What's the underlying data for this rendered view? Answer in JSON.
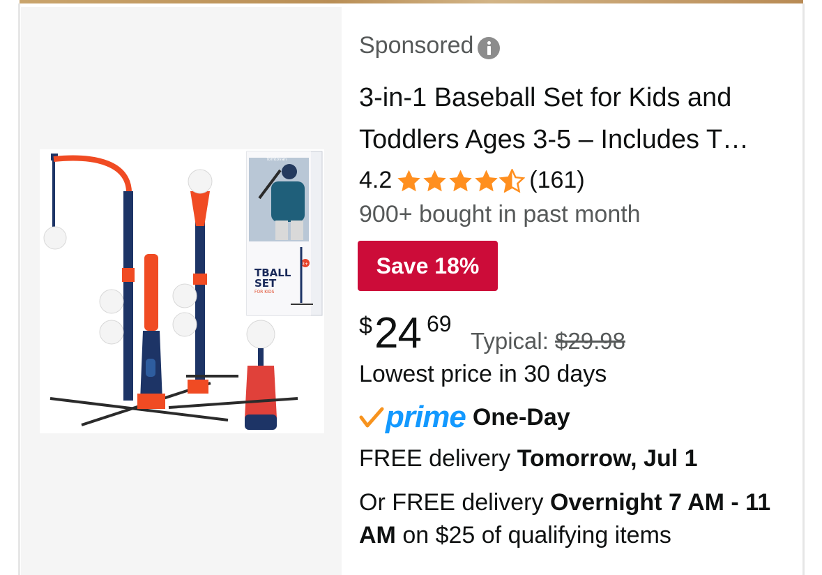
{
  "sponsored_label": "Sponsored",
  "title_lines": [
    "3-in-1 Baseball Set for Kids and",
    "Toddlers Ages 3-5 – Includes T…"
  ],
  "rating": {
    "value": "4.2",
    "stars": 4.5,
    "count": "(161)"
  },
  "bought_text": "900+ bought in past month",
  "save_badge": "Save 18%",
  "price": {
    "symbol": "$",
    "whole": "24",
    "fraction": "69"
  },
  "typical": {
    "label": "Typical: ",
    "value": "$29.98"
  },
  "lowest_price": "Lowest price in 30 days",
  "prime": {
    "word": "prime",
    "service": "One-Day"
  },
  "delivery": {
    "free_prefix": "FREE delivery ",
    "free_date": "Tomorrow, Jul 1",
    "alt_prefix": "Or FREE delivery ",
    "alt_window": "Overnight 7 AM - 11 AM",
    "alt_suffix": " on $25 of qualifying items"
  },
  "box_text": {
    "brand": "Tomtovan",
    "title": "TBALL",
    "title2": "SET",
    "subtitle": "FOR KIDS",
    "age": "3+"
  },
  "colors": {
    "save_badge": "#cc0c39",
    "star": "#ff8f1f",
    "prime_blue": "#1399ff",
    "prime_check": "#f7931e"
  }
}
